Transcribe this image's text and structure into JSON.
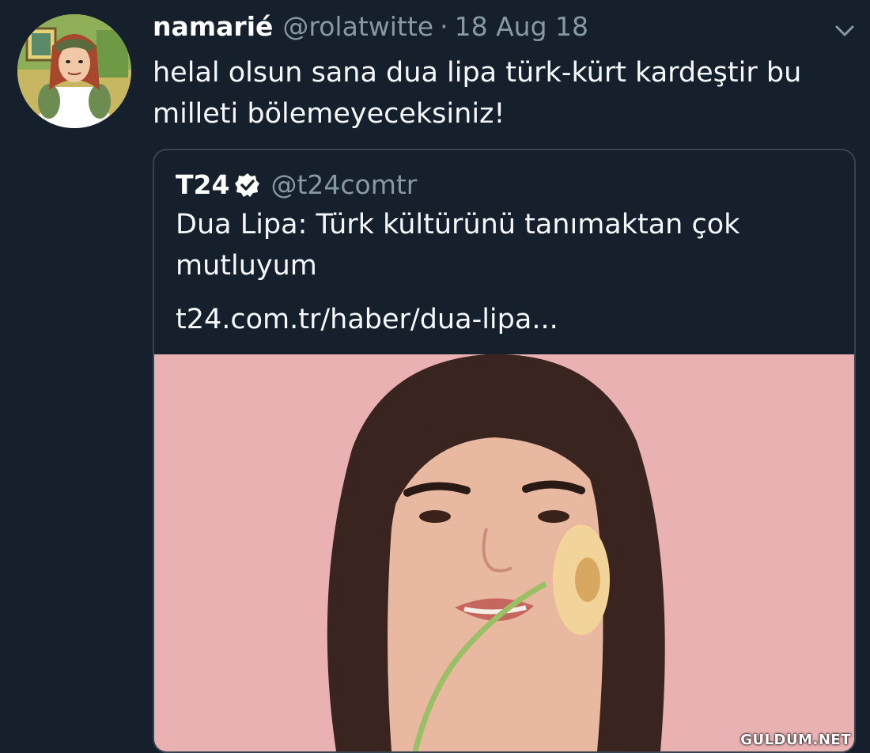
{
  "tweet": {
    "display_name": "namarié",
    "handle": "@rolatwitte",
    "separator": "·",
    "timestamp": "18 Aug 18",
    "avatar_icon": "cartoon-avatar",
    "menu_icon": "chevron-down-icon",
    "text": "helal olsun sana dua lipa türk-kürt kardeştir bu milleti bölemeyeceksiniz!"
  },
  "quoted_tweet": {
    "display_name": "T24",
    "verified_icon": "verified-badge-icon",
    "handle": "@t24comtr",
    "text": "Dua Lipa: Türk kültürünü tanımaktan çok mutluyum",
    "link": "t24.com.tr/haber/dua-lipa...",
    "media_icon": "portrait-photo"
  },
  "watermark": "GULDUM.NET",
  "colors": {
    "background": "#16202c",
    "border": "#38444d",
    "muted_text": "#8899a6",
    "text": "#f5f8fa",
    "photo_background": "#eab1b3"
  }
}
